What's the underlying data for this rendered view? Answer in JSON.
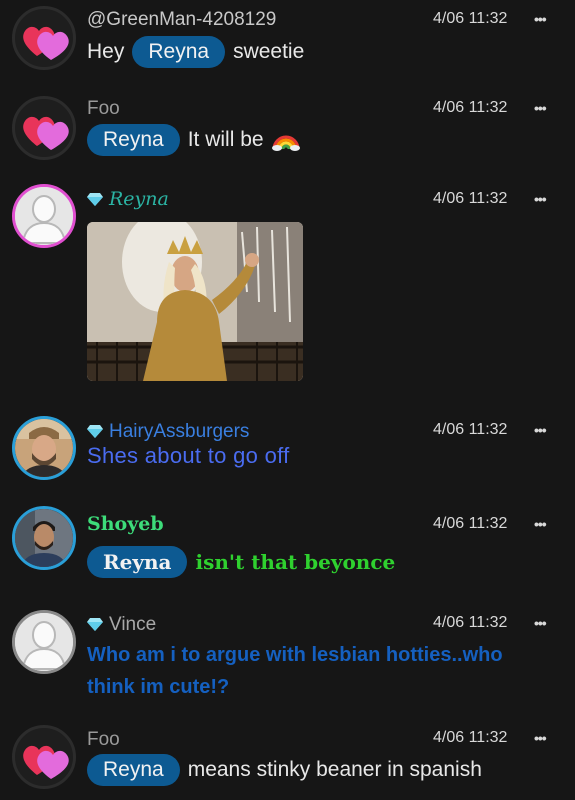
{
  "messages": [
    {
      "user": "@GreenMan-4208129",
      "time": "4/06 11:32",
      "menu": "•••",
      "parts": [
        "Hey",
        "Reyna",
        "sweetie"
      ],
      "avatar_icon": "heart-icon"
    },
    {
      "user": "Foo",
      "time": "4/06 11:32",
      "menu": "•••",
      "parts": [
        "Reyna",
        "It will be"
      ],
      "emoji": "rainbow-icon",
      "avatar_icon": "heart-icon"
    },
    {
      "user": "Reyna",
      "time": "4/06 11:32",
      "menu": "•••",
      "badge": "diamond-icon",
      "image": "gif-image",
      "avatar_icon": "user-silhouette-icon"
    },
    {
      "user": "HairyAssburgers",
      "time": "4/06 11:32",
      "menu": "•••",
      "badge": "diamond-icon",
      "text": "Shes about to go off",
      "avatar_icon": "user-photo"
    },
    {
      "user": "Shoyeb",
      "time": "4/06 11:32",
      "menu": "•••",
      "parts": [
        "Reyna",
        "isn't that beyonce"
      ],
      "avatar_icon": "user-photo"
    },
    {
      "user": "Vince",
      "time": "4/06 11:32",
      "menu": "•••",
      "badge": "diamond-icon",
      "text_line1": "Who am i to argue with lesbian hotties..who",
      "text_line2": "think im cute!?",
      "avatar_icon": "user-silhouette-icon"
    },
    {
      "user": "Foo",
      "time": "4/06 11:32",
      "menu": "•••",
      "parts": [
        "Reyna",
        "means stinky beaner in spanish"
      ],
      "avatar_icon": "heart-icon"
    }
  ],
  "colors": {
    "background": "#161616",
    "pill": "#0d5a92",
    "blue_text": "#4a6cf0",
    "green_text": "#2fd12f",
    "dark_blue_text": "#1560c0",
    "reyna_teal": "#2bb3a3"
  }
}
